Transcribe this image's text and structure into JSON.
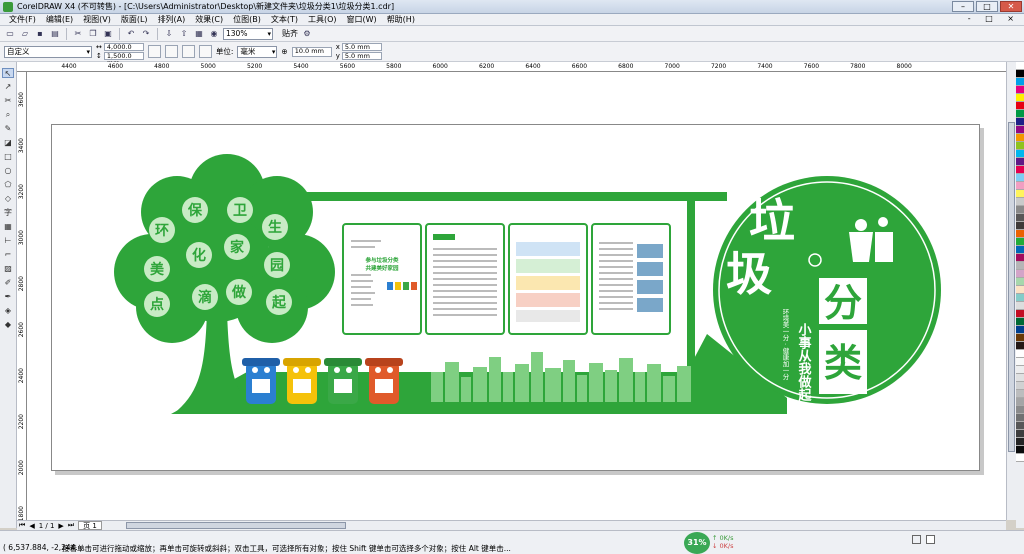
{
  "window": {
    "title": "CorelDRAW X4 (不可转售) - [C:\\Users\\Administrator\\Desktop\\新建文件夹\\垃圾分类1\\垃圾分类1.cdr]",
    "min": "–",
    "max": "□",
    "close": "✕"
  },
  "menu": [
    "文件(F)",
    "编辑(E)",
    "视图(V)",
    "版面(L)",
    "排列(A)",
    "效果(C)",
    "位图(B)",
    "文本(T)",
    "工具(O)",
    "窗口(W)",
    "帮助(H)"
  ],
  "menu_right": "- □ ×",
  "toolbar": {
    "zoom": "130%",
    "snap": "贴齐"
  },
  "propbar": {
    "preset": "自定义",
    "width": "4,000.0 mm",
    "height": "1,500.0 mm",
    "unit_label": "单位:",
    "unit": "毫米",
    "nudge": "10.0 mm",
    "dup_x": "5.0 mm",
    "dup_y": "5.0 mm"
  },
  "ruler_ticks": [
    "4400",
    "4600",
    "4800",
    "5000",
    "5200",
    "5400",
    "5600",
    "5800",
    "6000",
    "6200",
    "6400",
    "6600",
    "6800",
    "7000",
    "7200",
    "7400",
    "7600",
    "7800",
    "8000"
  ],
  "vruler_ticks": [
    "3600",
    "3400",
    "3200",
    "3000",
    "2800",
    "2600",
    "2400",
    "2200",
    "2000",
    "1800"
  ],
  "tree_chars": [
    "保",
    "卫",
    "环",
    "生",
    "化",
    "家",
    "美",
    "园",
    "滴",
    "做",
    "点",
    "起"
  ],
  "panels": {
    "p2_heading": "参与垃圾分类",
    "p2_sub": "共建美好家园"
  },
  "emblem": {
    "main1": "垃",
    "main2": "圾",
    "fen": "分",
    "lei": "类",
    "slogan": "小事从我做起",
    "side": "环境美一分 · 健康加一分"
  },
  "pages": {
    "current": "1 / 1",
    "tab": "页 1"
  },
  "status": {
    "coords": "( 6,537.884, -2,244....",
    "hint": "接着单击可进行拖动或缩放；再单击可旋转或斜斜；双击工具，可选择所有对象；按住 Shift 键单击可选择多个对象；按住 Alt 键单击...",
    "cpu": "31%",
    "net_up": "0K/s",
    "net_down": "0K/s"
  },
  "colors": {
    "green": "#2ea53a",
    "light_green": "#8ed08a",
    "blue_bin": "#2b7fd1",
    "yellow_bin": "#f5c20a",
    "green_bin": "#3aa847",
    "red_bin": "#e05a2a"
  },
  "palette": [
    "#ffffff",
    "#000000",
    "#00a0e9",
    "#e4007f",
    "#fff100",
    "#e60012",
    "#009944",
    "#1d2088",
    "#920783",
    "#f39800",
    "#8fc31f",
    "#00b7ee",
    "#601986",
    "#e5004f",
    "#7ecef4",
    "#f19ec2",
    "#fff45c",
    "#c9caca",
    "#898989",
    "#595757",
    "#3e3a39",
    "#eb6100",
    "#22ac38",
    "#0068b7",
    "#a40b5d",
    "#b5b5b6",
    "#d3a4c8",
    "#a7d7ac",
    "#fce2c4",
    "#84ccc9",
    "#dcdddd",
    "#c30d23",
    "#006934",
    "#003f8e",
    "#6a3906",
    "#231815",
    "#ffffff",
    "#f7f8f8",
    "#ecedee",
    "#dfe0e1",
    "#d0d1d2",
    "#bcbdbe",
    "#a4a5a6",
    "#8a8b8c",
    "#707172",
    "#565758",
    "#3c3d3e",
    "#232425",
    "#0a0b0c",
    "#ffffff"
  ]
}
